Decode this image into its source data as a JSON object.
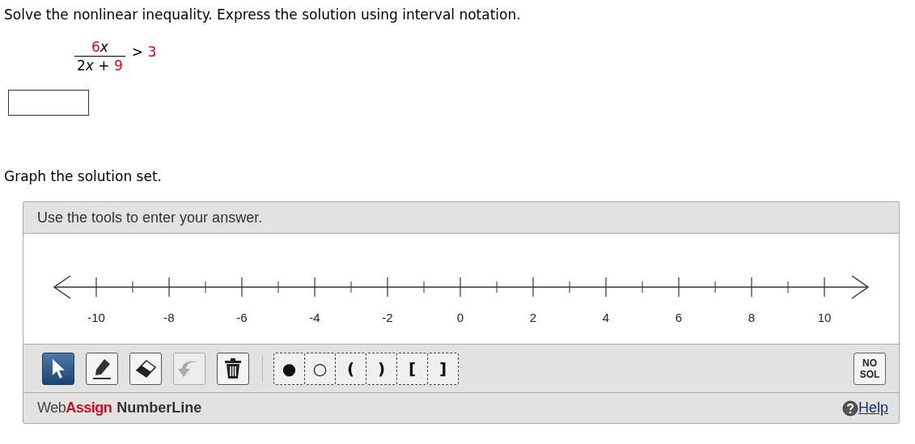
{
  "question": {
    "prompt": "Solve the nonlinear inequality. Express the solution using interval notation.",
    "numerator": [
      {
        "text": "6",
        "kind": "number"
      },
      {
        "text": "x",
        "kind": "variable"
      }
    ],
    "denominator": [
      {
        "text": "2",
        "kind": "plain"
      },
      {
        "text": "x",
        "kind": "variable"
      },
      {
        "text": " + ",
        "kind": "plain"
      },
      {
        "text": "9",
        "kind": "number"
      }
    ],
    "right_side": [
      {
        "text": "> ",
        "kind": "plain"
      },
      {
        "text": "3",
        "kind": "number"
      }
    ]
  },
  "graph_prompt": "Graph the solution set.",
  "panel": {
    "header": "Use the tools to enter your answer.",
    "axis_labels": [
      "-10",
      "-8",
      "-6",
      "-4",
      "-2",
      "0",
      "2",
      "4",
      "6",
      "8",
      "10"
    ],
    "tools": [
      {
        "kind": "pointer",
        "selected": true,
        "disabled": false
      },
      {
        "kind": "pencil",
        "selected": false,
        "disabled": false
      },
      {
        "kind": "eraser",
        "selected": false,
        "disabled": false
      },
      {
        "kind": "undo",
        "selected": false,
        "disabled": true
      },
      {
        "kind": "trash",
        "selected": false,
        "disabled": false
      }
    ],
    "symbols": [
      {
        "text": "●"
      },
      {
        "text": "○"
      },
      {
        "text": "("
      },
      {
        "text": ")"
      },
      {
        "text": "["
      },
      {
        "text": "]"
      }
    ],
    "no_solution": "NO SOL",
    "brand": {
      "web": "Web",
      "assign": "Assign",
      "product": "NumberLine"
    },
    "help": "Help"
  }
}
